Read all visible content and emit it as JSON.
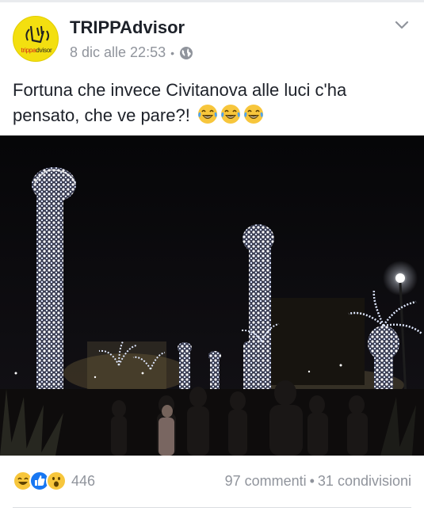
{
  "post": {
    "page_name": "TRIPPAdvisor",
    "avatar_text_red": "trippa",
    "avatar_text_dark": "dvisor",
    "timestamp": "8 dic alle 22:53",
    "privacy_icon": "globe-icon",
    "caption": "Fortuna che invece Civitanova alle luci c'ha pensato, che ve pare?!",
    "caption_emojis": [
      "laughing-tears-emoji",
      "laughing-tears-emoji",
      "laughing-tears-emoji"
    ],
    "photo_icon": "night-street-lights-photo"
  },
  "footer": {
    "reaction_icons": [
      "haha-reaction-icon",
      "like-reaction-icon",
      "wow-reaction-icon"
    ],
    "reaction_count": "446",
    "comments": "97 commenti",
    "separator": "•",
    "shares": "31 condivisioni"
  },
  "colors": {
    "text_primary": "#1d2129",
    "text_secondary": "#90949c",
    "like_blue": "#1877f2",
    "reaction_yellow": "#f7c63c",
    "avatar_yellow": "#f3df10"
  }
}
